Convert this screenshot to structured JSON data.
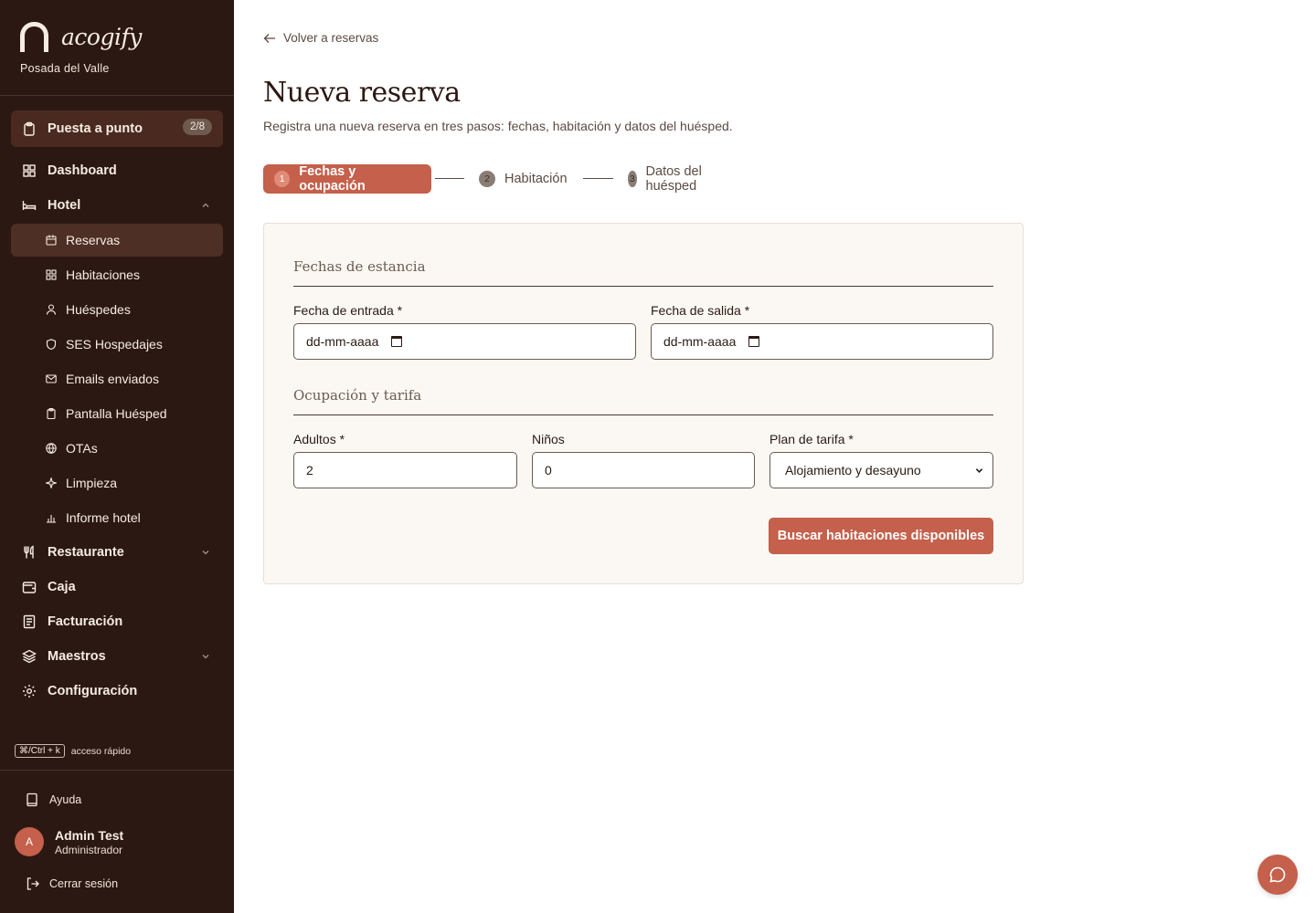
{
  "brand": {
    "name": "acogify",
    "hotel": "Posada del Valle"
  },
  "sidebar": {
    "setup": {
      "label": "Puesta a punto",
      "badge": "2/8"
    },
    "items": [
      {
        "label": "Dashboard",
        "icon": "grid-icon"
      },
      {
        "label": "Hotel",
        "icon": "bed-icon"
      },
      {
        "label": "Reservas",
        "icon": "calendar-icon"
      },
      {
        "label": "Habitaciones",
        "icon": "grid-icon"
      },
      {
        "label": "Huéspedes",
        "icon": "user-icon"
      },
      {
        "label": "SES Hospedajes",
        "icon": "shield-icon"
      },
      {
        "label": "Emails enviados",
        "icon": "mail-icon"
      },
      {
        "label": "Pantalla Huésped",
        "icon": "clipboard-icon"
      },
      {
        "label": "OTAs",
        "icon": "globe-icon"
      },
      {
        "label": "Limpieza",
        "icon": "sparkle-icon"
      },
      {
        "label": "Informe hotel",
        "icon": "bar-chart-icon"
      },
      {
        "label": "Restaurante",
        "icon": "utensils-icon"
      },
      {
        "label": "Caja",
        "icon": "wallet-icon"
      },
      {
        "label": "Facturación",
        "icon": "receipt-icon"
      },
      {
        "label": "Maestros",
        "icon": "layers-icon"
      },
      {
        "label": "Configuración",
        "icon": "gear-icon"
      }
    ],
    "shortcut_key": "⌘/Ctrl + k",
    "shortcut_label": "acceso rápido",
    "help": "Ayuda",
    "user": {
      "initial": "A",
      "name": "Admin Test",
      "role": "Administrador"
    },
    "logout": "Cerrar sesión"
  },
  "main": {
    "back_link": "Volver a reservas",
    "title": "Nueva reserva",
    "subtitle": "Registra una nueva reserva en tres pasos: fechas, habitación y datos del huésped.",
    "steps": [
      {
        "num": "1",
        "label": "Fechas y ocupación"
      },
      {
        "num": "2",
        "label": "Habitación"
      },
      {
        "num": "3",
        "label": "Datos del huésped"
      }
    ],
    "form": {
      "section_dates": "Fechas de estancia",
      "checkin_label": "Fecha de entrada *",
      "checkin_value": "dd-mm-aaaa",
      "checkout_label": "Fecha de salida *",
      "checkout_value": "dd-mm-aaaa",
      "section_occupancy": "Ocupación y tarifa",
      "adults_label": "Adultos *",
      "adults_value": "2",
      "children_label": "Niños",
      "children_value": "0",
      "rate_label": "Plan de tarifa *",
      "rate_value": "Alojamiento y desayuno",
      "submit": "Buscar habitaciones disponibles"
    }
  },
  "colors": {
    "sidebar_bg": "#2c1812",
    "accent": "#c4604b",
    "card_bg": "#fbf8f3"
  }
}
